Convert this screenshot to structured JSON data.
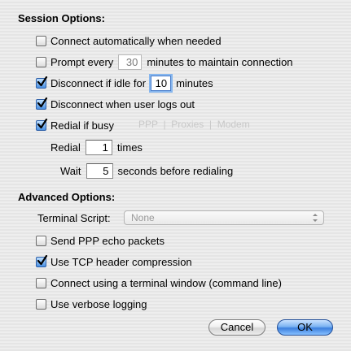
{
  "session": {
    "heading": "Session Options:",
    "connect_auto": {
      "label": "Connect automatically when needed",
      "checked": false
    },
    "prompt": {
      "label_before": "Prompt every",
      "value": "30",
      "label_after": "minutes to maintain connection",
      "checked": false
    },
    "disconnect_idle": {
      "label_before": "Disconnect if idle for",
      "value": "10",
      "label_after": "minutes",
      "checked": true
    },
    "disconnect_logout": {
      "label": "Disconnect when user logs out",
      "checked": true
    },
    "redial_busy": {
      "label": "Redial if busy",
      "checked": true
    },
    "redial_count": {
      "label_before": "Redial",
      "value": "1",
      "label_after": "times"
    },
    "wait": {
      "label_before": "Wait",
      "value": "5",
      "label_after": "seconds before redialing"
    }
  },
  "advanced": {
    "heading": "Advanced Options:",
    "terminal_script": {
      "label": "Terminal Script:",
      "value": "None"
    },
    "echo_packets": {
      "label": "Send PPP echo packets",
      "checked": false
    },
    "tcp_compression": {
      "label": "Use TCP header compression",
      "checked": true
    },
    "terminal_window": {
      "label": "Connect using a terminal window (command line)",
      "checked": false
    },
    "verbose_logging": {
      "label": "Use verbose logging",
      "checked": false
    }
  },
  "buttons": {
    "cancel": "Cancel",
    "ok": "OK"
  },
  "colors": {
    "accent": "#4a90e2",
    "default_button": "#3c80de"
  }
}
